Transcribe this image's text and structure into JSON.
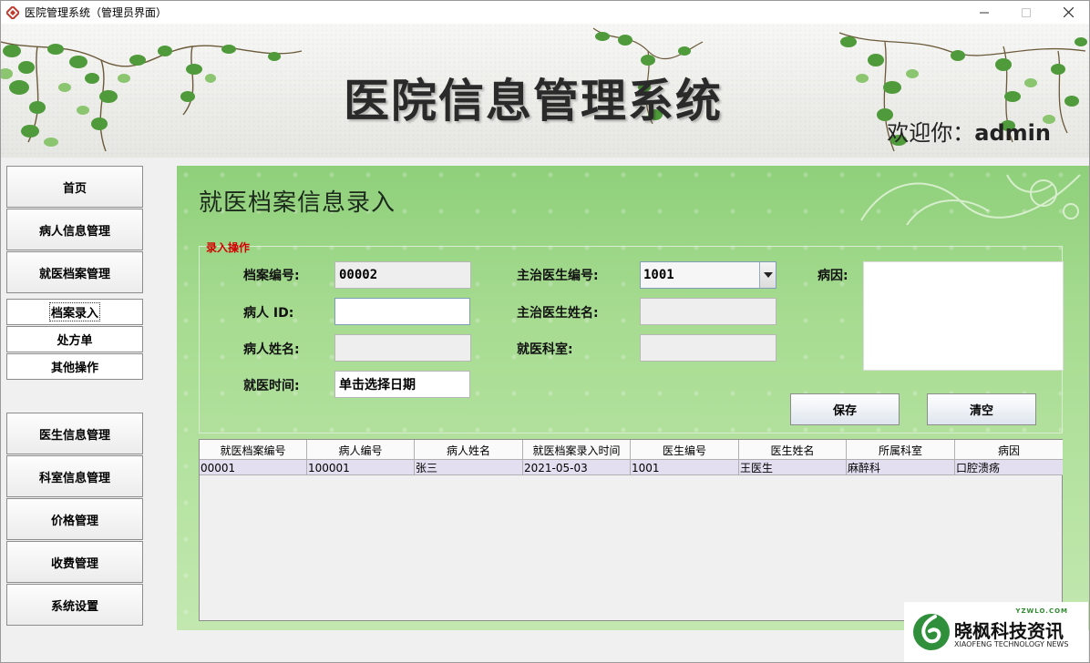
{
  "window": {
    "title": "医院管理系统（管理员界面）",
    "icon": "app-diamond-icon",
    "controls": [
      "minimize-icon",
      "maximize-icon",
      "close-icon"
    ]
  },
  "banner": {
    "title": "医院信息管理系统",
    "welcome_prefix": "欢迎你：",
    "username": "admin"
  },
  "sidebar": {
    "items": [
      {
        "label": "首页"
      },
      {
        "label": "病人信息管理"
      },
      {
        "label": "就医档案管理"
      }
    ],
    "sub_items": [
      {
        "label": "档案录入",
        "active": true
      },
      {
        "label": "处方单"
      },
      {
        "label": "其他操作"
      }
    ],
    "items2": [
      {
        "label": "医生信息管理"
      },
      {
        "label": "科室信息管理"
      },
      {
        "label": "价格管理"
      },
      {
        "label": "收费管理"
      },
      {
        "label": "系统设置"
      }
    ]
  },
  "main": {
    "page_title": "就医档案信息录入",
    "group_title": "录入操作",
    "form": {
      "record_no_label": "档案编号:",
      "record_no_value": "00002",
      "patient_id_label": "病人 ID:",
      "patient_id_value": "",
      "patient_name_label": "病人姓名:",
      "patient_name_value": "",
      "visit_time_label": "就医时间:",
      "visit_time_value": "单击选择日期",
      "doctor_id_label": "主治医生编号:",
      "doctor_id_value": "1001",
      "doctor_name_label": "主治医生姓名:",
      "doctor_name_value": "",
      "dept_label": "就医科室:",
      "dept_value": "",
      "cause_label": "病因:",
      "cause_value": ""
    },
    "buttons": {
      "save": "保存",
      "clear": "清空"
    },
    "table": {
      "columns": [
        "就医档案编号",
        "病人编号",
        "病人姓名",
        "就医档案录入时间",
        "医生编号",
        "医生姓名",
        "所属科室",
        "病因"
      ],
      "rows": [
        [
          "00001",
          "100001",
          "张三",
          "2021-05-03",
          "1001",
          "王医生",
          "麻醉科",
          "口腔溃疡"
        ]
      ]
    }
  },
  "watermark": {
    "url": "YZWLO.COM",
    "name_cn": "晓枫科技资讯",
    "name_en": "XIAOFENG TECHNOLOGY NEWS",
    "logo": "xiaofeng-logo-icon"
  },
  "colors": {
    "panel_green": "#a8dc92",
    "legend_red": "#d20000",
    "row_highlight": "#e3dff0"
  }
}
